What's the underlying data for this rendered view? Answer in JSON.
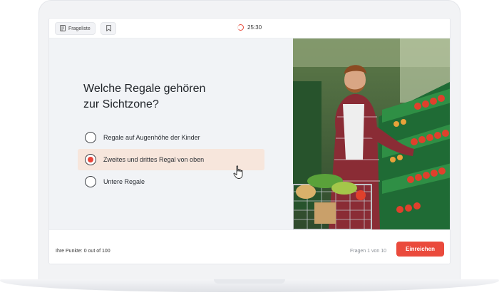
{
  "toolbar": {
    "question_list_label": "Frageliste",
    "question_list_icon": "list-icon",
    "bookmark_icon": "bookmark-icon",
    "timer": "25:30",
    "timer_icon": "timer-ring-icon"
  },
  "question": {
    "text_line1": "Welche Regale gehören",
    "text_line2": "zur Sichtzone?",
    "options": [
      {
        "label": "Regale auf Augenhöhe der Kinder",
        "selected": false
      },
      {
        "label": "Zweites und drittes Regal von oben",
        "selected": true
      },
      {
        "label": "Untere Regale",
        "selected": false
      }
    ]
  },
  "footer": {
    "points_label": "Ihre Punkte: 0 out of 100",
    "progress_label": "Fragen 1 von 10",
    "submit_label": "Einreichen"
  },
  "colors": {
    "accent": "#ea4a3c",
    "selected_bg": "#f7e6dc",
    "panel_bg": "#f1f3f6"
  }
}
